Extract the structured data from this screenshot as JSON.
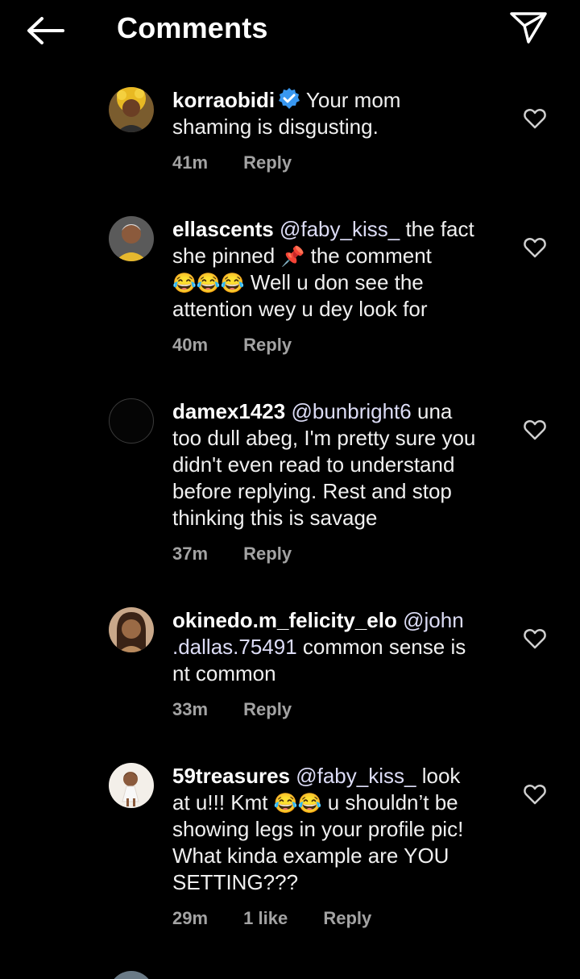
{
  "header": {
    "title": "Comments",
    "back_icon": "arrow-left-icon",
    "send_icon": "paper-plane-icon"
  },
  "comments": [
    {
      "username": "korraobidi",
      "verified": true,
      "text_parts": [
        "Your mom",
        "shaming is disgusting."
      ],
      "time": "41m",
      "reply": "Reply"
    },
    {
      "username": "ellascents",
      "mention": "@faby_kiss_",
      "line1_after": "the fact",
      "line2": "she pinned",
      "emoji_pin": "📌",
      "line2_after": "the comment",
      "emojis_line3": "😂😂😂",
      "line3_after": "Well u don see the",
      "line4": "attention wey u dey look for",
      "time": "40m",
      "reply": "Reply"
    },
    {
      "username": "damex1423",
      "mention": "@bunbright6",
      "line1_after": "una",
      "line2": "too dull abeg, I'm pretty sure you",
      "line3": "didn't even read to understand",
      "line4": "before replying. Rest and stop",
      "line5": "thinking this is savage",
      "time": "37m",
      "reply": "Reply"
    },
    {
      "username": "okinedo.m_felicity_elo",
      "mention_a": "@john",
      "mention_b": ".dallas.75491",
      "line2_after": "common sense is",
      "line3": "nt common",
      "time": "33m",
      "reply": "Reply"
    },
    {
      "username": "59treasures",
      "mention": "@faby_kiss_",
      "line1_after": "look",
      "line2": "at u!!! Kmt",
      "emojis_line2": "😂😂",
      "line2_after": "u shouldn’t be",
      "line3": "showing legs in your profile pic!",
      "line4": "What kinda example are YOU",
      "line5": "SETTING???",
      "time": "29m",
      "likes": "1 like",
      "reply": "Reply"
    }
  ],
  "colors": {
    "background": "#000000",
    "text": "#f0f0f0",
    "meta": "#a3a3a3",
    "verified": "#3897f0"
  }
}
